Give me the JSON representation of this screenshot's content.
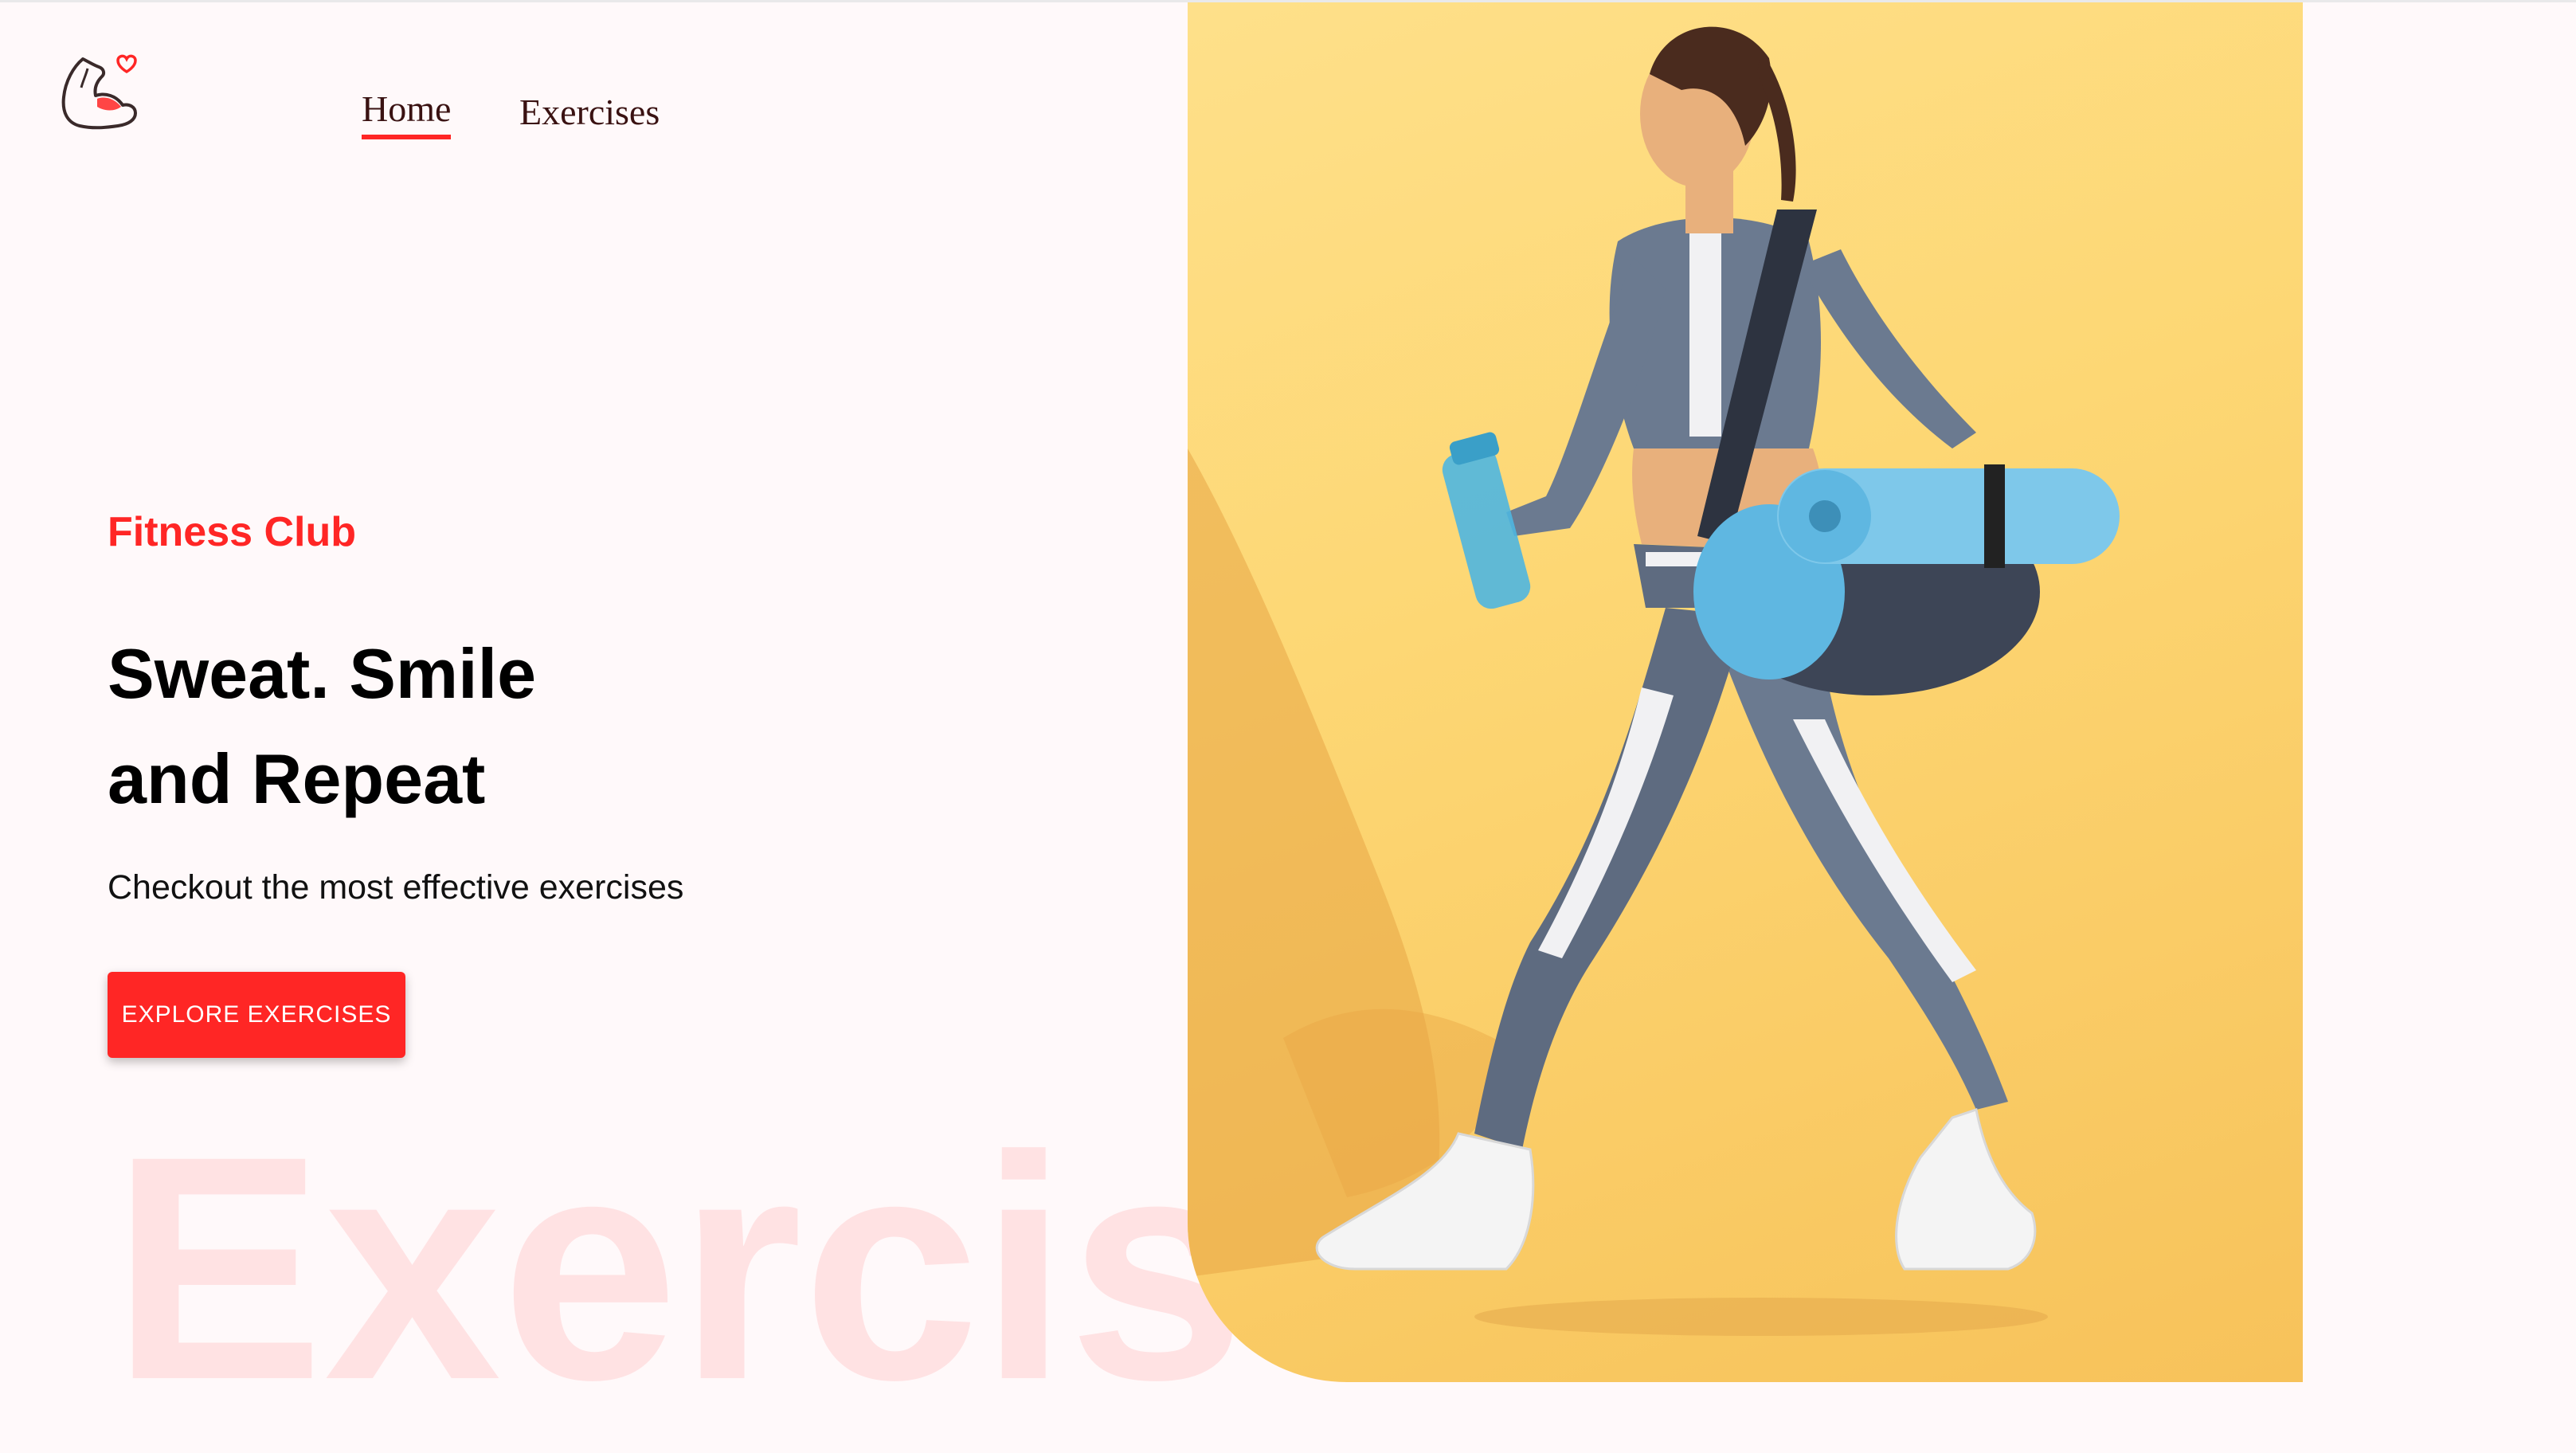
{
  "navbar": {
    "logo_icon": "flexed-arm-heart-icon",
    "links": [
      {
        "label": "Home",
        "active": true
      },
      {
        "label": "Exercises",
        "active": false
      }
    ]
  },
  "hero": {
    "kicker": "Fitness Club",
    "title_line1": "Sweat. Smile",
    "title_line2": "and Repeat",
    "subtitle": "Checkout the most effective exercises",
    "cta_label": "EXPLORE EXERCISES",
    "watermark": "Exercises",
    "image_alt": "Woman walking with water bottle and yoga mat"
  },
  "colors": {
    "accent": "#ff2625",
    "background": "#fff9fa",
    "image_background": "#fdd774"
  }
}
